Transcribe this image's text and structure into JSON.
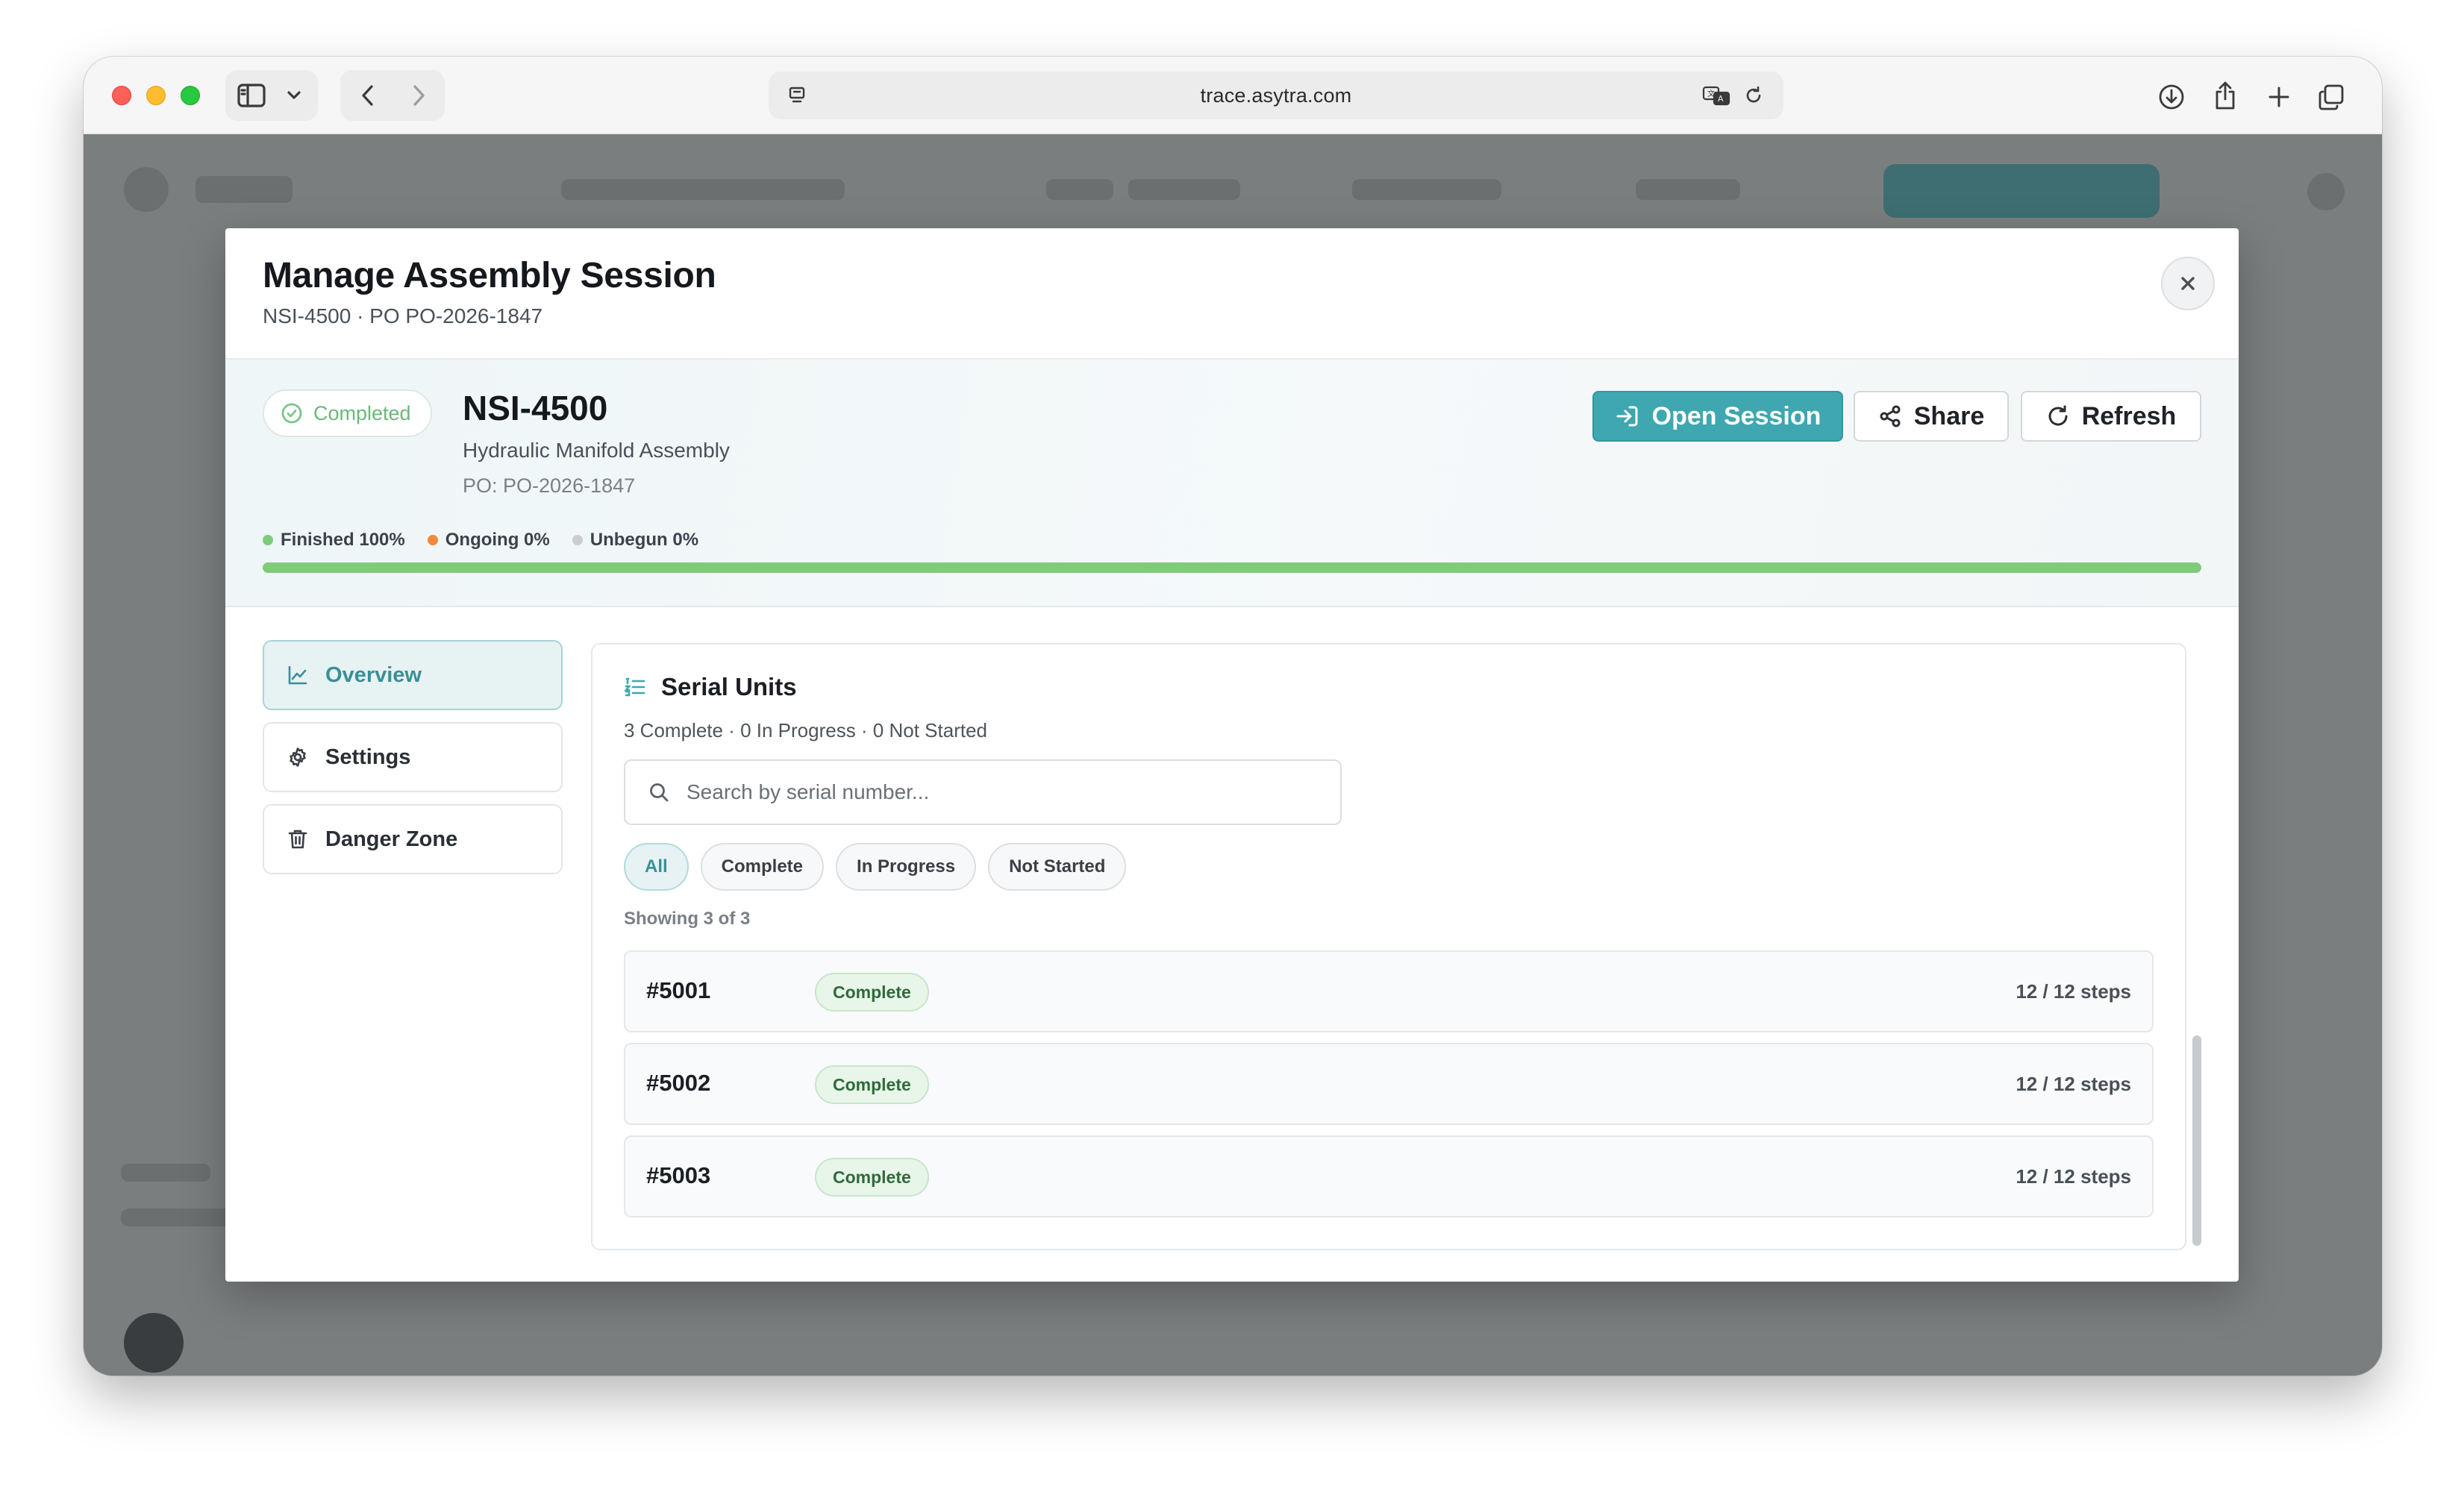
{
  "browser": {
    "url": "trace.asytra.com"
  },
  "modal": {
    "title": "Manage Assembly Session",
    "subtitle": "NSI-4500 · PO PO-2026-1847"
  },
  "summary": {
    "status": "Completed",
    "product_code": "NSI-4500",
    "product_name": "Hydraulic Manifold Assembly",
    "po": "PO: PO-2026-1847",
    "buttons": {
      "open_session": "Open Session",
      "share": "Share",
      "refresh": "Refresh"
    },
    "legend": [
      {
        "label": "Finished 100%",
        "color": "#7fcb7a"
      },
      {
        "label": "Ongoing 0%",
        "color": "#f08a3c"
      },
      {
        "label": "Unbegun 0%",
        "color": "#c9cdd1"
      }
    ],
    "progress": {
      "finished": 1.0,
      "ongoing": 0.0,
      "unbegun": 0.0
    }
  },
  "sidebar": {
    "items": [
      {
        "label": "Overview",
        "icon": "chart-line-icon",
        "active": true
      },
      {
        "label": "Settings",
        "icon": "gear-icon",
        "active": false
      },
      {
        "label": "Danger Zone",
        "icon": "trash-icon",
        "active": false
      }
    ]
  },
  "serial_units": {
    "title": "Serial Units",
    "summary": "3 Complete · 0 In Progress · 0 Not Started",
    "search_placeholder": "Search by serial number...",
    "filters": [
      "All",
      "Complete",
      "In Progress",
      "Not Started"
    ],
    "active_filter": "All",
    "showing": "Showing 3 of 3",
    "rows": [
      {
        "serial": "#5001",
        "status": "Complete",
        "steps": "12 / 12 steps"
      },
      {
        "serial": "#5002",
        "status": "Complete",
        "steps": "12 / 12 steps"
      },
      {
        "serial": "#5003",
        "status": "Complete",
        "steps": "12 / 12 steps"
      }
    ]
  },
  "colors": {
    "accent": "#3ea7b0",
    "success": "#7fcb7a",
    "warning": "#f08a3c"
  }
}
